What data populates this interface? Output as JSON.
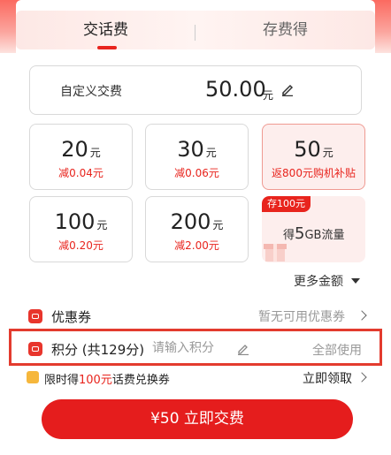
{
  "tabs": [
    {
      "label": "交话费",
      "active": true
    },
    {
      "label": "存费得",
      "active": false
    }
  ],
  "custom": {
    "label": "自定义交费",
    "amount": "50.00",
    "unit": "元"
  },
  "options": [
    {
      "amount": "20",
      "unit": "元",
      "sub": "减0.04元",
      "selected": false
    },
    {
      "amount": "30",
      "unit": "元",
      "sub": "减0.06元",
      "selected": false
    },
    {
      "amount": "50",
      "unit": "元",
      "sub": "返800元购机补贴",
      "selected": true
    },
    {
      "amount": "100",
      "unit": "元",
      "sub": "减0.20元",
      "selected": false
    },
    {
      "amount": "200",
      "unit": "元",
      "sub": "减2.00元",
      "selected": false
    }
  ],
  "promo": {
    "tag": "存100元",
    "prefix": "得",
    "highlight": "5",
    "suffix": "GB流量"
  },
  "more": {
    "label": "更多金额"
  },
  "coupon": {
    "label": "优惠券",
    "status": "暂无可用优惠券"
  },
  "points": {
    "label": "积分 (共129分)",
    "placeholder": "请输入积分",
    "use_all": "全部使用"
  },
  "exchange": {
    "prefix": "限时得",
    "highlight": "100元",
    "suffix": "话费兑换券",
    "action": "立即领取"
  },
  "pay_button": {
    "label": "¥50 立即交费"
  },
  "colors": {
    "accent": "#e8241d",
    "pay_button": "#e51d1d",
    "highlight_box": "#e33b2e",
    "selected_bg": "#fdeeed"
  }
}
